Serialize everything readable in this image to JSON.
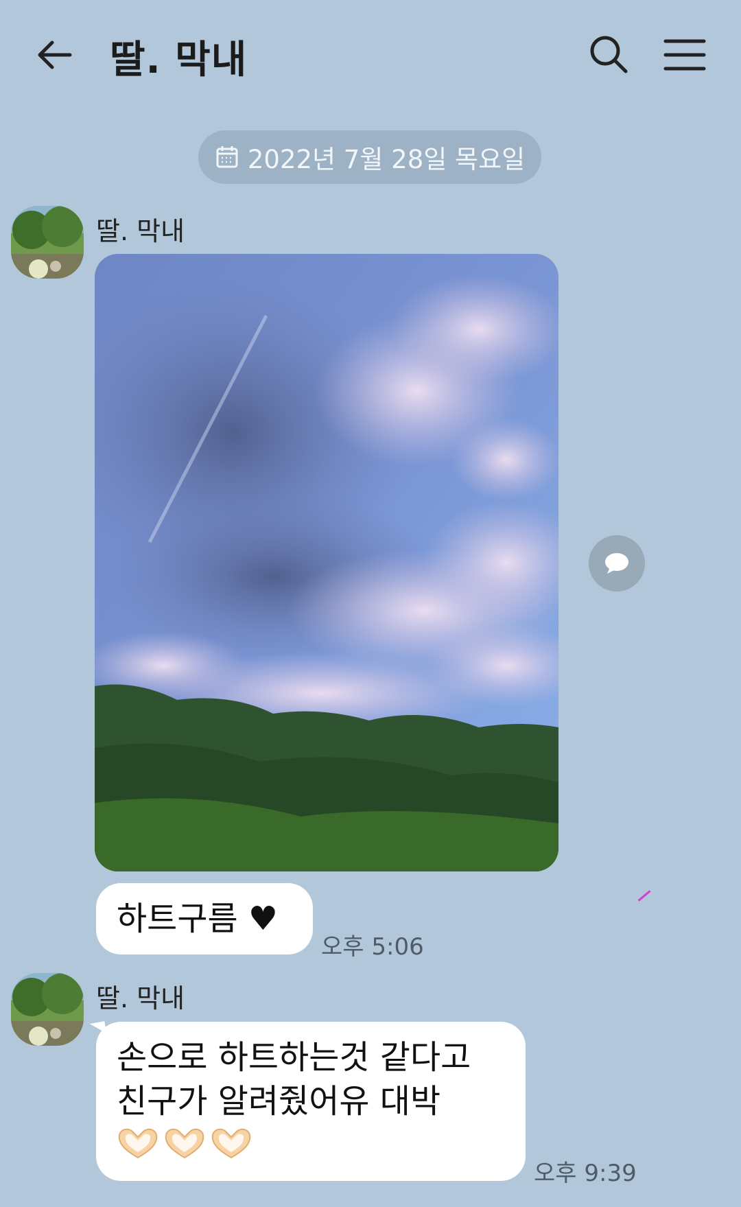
{
  "header": {
    "title": "딸. 막내",
    "back_icon": "arrow-left-icon",
    "search_icon": "search-icon",
    "menu_icon": "hamburger-menu-icon"
  },
  "date_divider": {
    "icon": "calendar-icon",
    "text": "2022년 7월 28일 목요일"
  },
  "messages": [
    {
      "sender": "딸. 막내",
      "photo": {
        "description_icon": "sky-clouds-photo"
      },
      "text": "하트구름 ♥",
      "time": "오후 5:06"
    },
    {
      "sender": "딸. 막내",
      "line1": "손으로 하트하는것 같다고",
      "line2": "친구가 알려줬어유 대박",
      "emoji": [
        "🫶",
        "🫶",
        "🫶"
      ],
      "time": "오후 9:39"
    }
  ],
  "colors": {
    "background": "#b2c7da",
    "bubble": "#ffffff",
    "date_pill": "#9fb2c4"
  }
}
